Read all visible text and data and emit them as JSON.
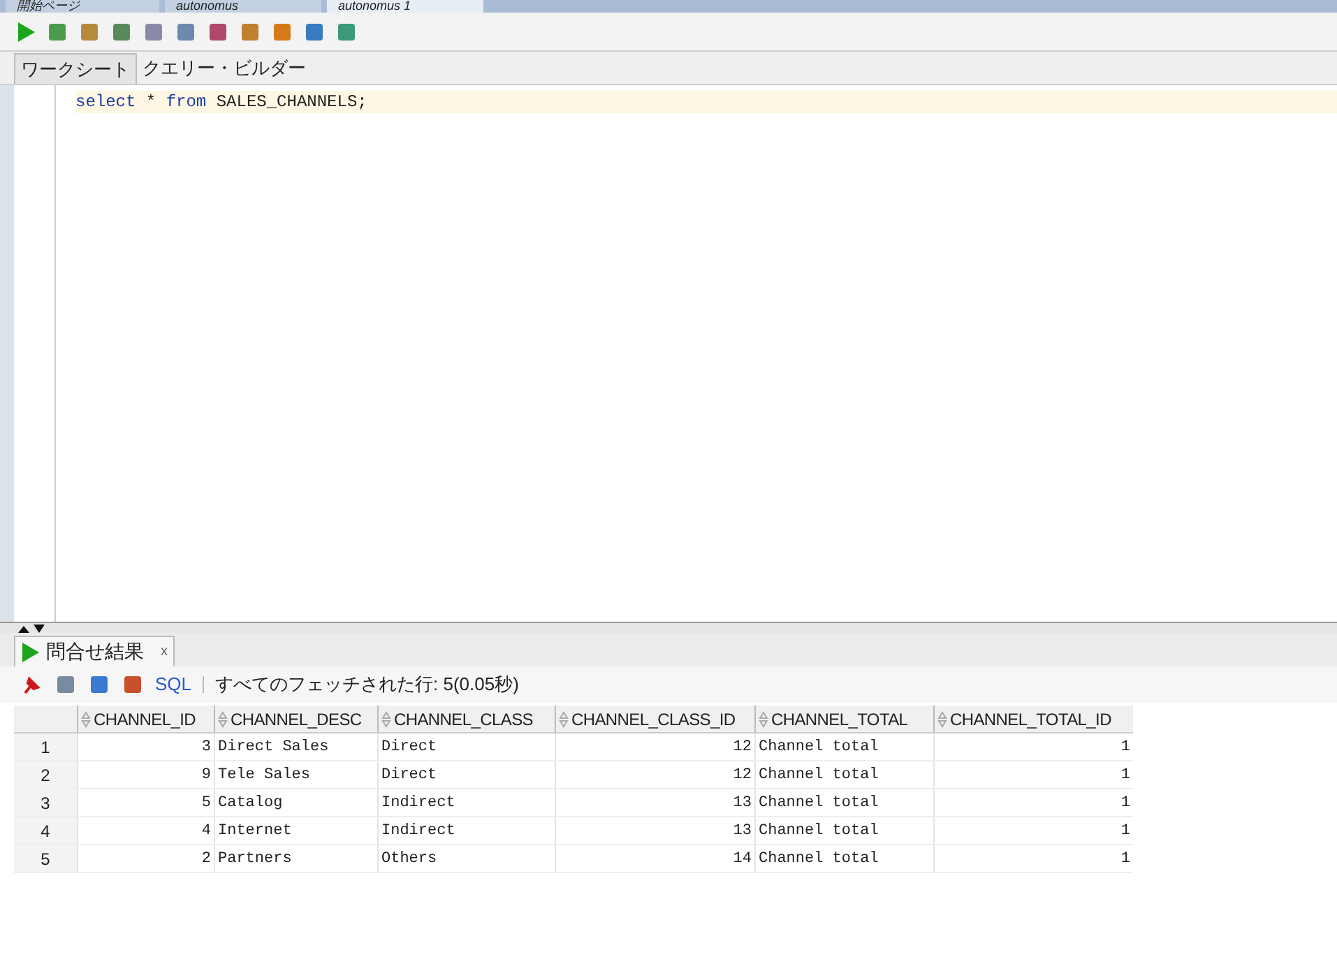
{
  "doc_tabs": [
    {
      "label": "開始ページ",
      "selected": false
    },
    {
      "label": "autonomus",
      "selected": false
    },
    {
      "label": "autonomus 1",
      "selected": true
    }
  ],
  "editor_tabs": [
    {
      "label": "ワークシート",
      "selected": true
    },
    {
      "label": "クエリー・ビルダー",
      "selected": false
    }
  ],
  "editor": {
    "lines": [
      [
        {
          "kind": "keyword",
          "text": "select"
        },
        {
          "kind": "plain",
          "text": " * "
        },
        {
          "kind": "keyword",
          "text": "from"
        },
        {
          "kind": "plain",
          "text": " SALES_CHANNELS;"
        }
      ]
    ]
  },
  "results_tab": {
    "label": "問合せ結果",
    "close": "x"
  },
  "results_toolbar": {
    "sql_link": "SQL",
    "status": "すべてのフェッチされた行: 5(0.05秒)"
  },
  "table": {
    "columns": [
      {
        "label": "CHANNEL_ID",
        "kind": "number"
      },
      {
        "label": "CHANNEL_DESC",
        "kind": "text"
      },
      {
        "label": "CHANNEL_CLASS",
        "kind": "text"
      },
      {
        "label": "CHANNEL_CLASS_ID",
        "kind": "number"
      },
      {
        "label": "CHANNEL_TOTAL",
        "kind": "text"
      },
      {
        "label": "CHANNEL_TOTAL_ID",
        "kind": "number"
      }
    ],
    "rows": [
      {
        "num": "1",
        "cells": [
          "3",
          "Direct Sales",
          "Direct",
          "12",
          "Channel total",
          "1"
        ]
      },
      {
        "num": "2",
        "cells": [
          "9",
          "Tele Sales",
          "Direct",
          "12",
          "Channel total",
          "1"
        ]
      },
      {
        "num": "3",
        "cells": [
          "5",
          "Catalog",
          "Indirect",
          "13",
          "Channel total",
          "1"
        ]
      },
      {
        "num": "4",
        "cells": [
          "4",
          "Internet",
          "Indirect",
          "13",
          "Channel total",
          "1"
        ]
      },
      {
        "num": "5",
        "cells": [
          "2",
          "Partners",
          "Others",
          "14",
          "Channel total",
          "1"
        ]
      }
    ]
  }
}
